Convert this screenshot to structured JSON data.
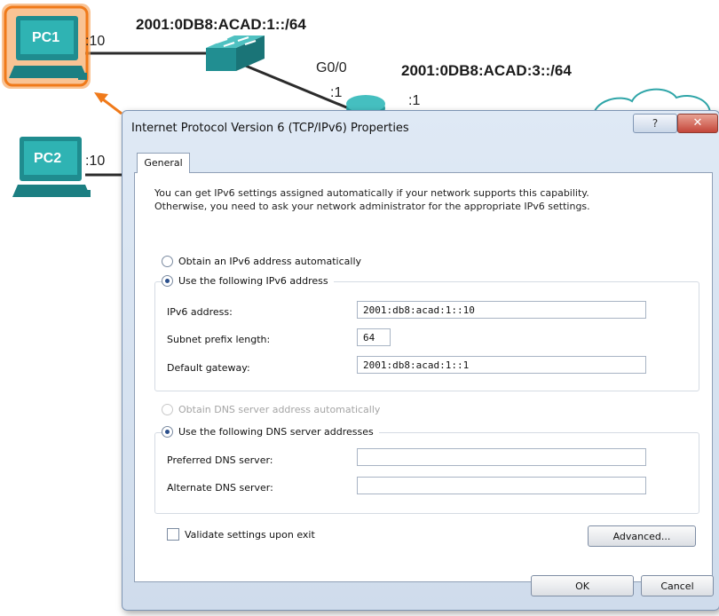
{
  "topology": {
    "lan1_prefix": "2001:0DB8:ACAD:1::/64",
    "lan3_prefix": "2001:0DB8:ACAD:3::/64",
    "pc1": {
      "name": "PC1",
      "suffix": ":10"
    },
    "pc2": {
      "name": "PC2",
      "suffix": ":10"
    },
    "router_port": "G0/0",
    "router_port_suffix": ":1",
    "router_right_suffix": ":1",
    "highlight_color": "#f07a1a"
  },
  "dialog": {
    "title": "Internet Protocol Version 6 (TCP/IPv6) Properties",
    "help_glyph": "?",
    "close_glyph": "✕",
    "tab_general": "General",
    "intro_line1": "You can get IPv6 settings assigned automatically if your network supports this capability.",
    "intro_line2": "Otherwise, you need to ask your network administrator for the appropriate IPv6 settings.",
    "radio_obtain_ip": "Obtain an IPv6 address automatically",
    "radio_use_ip": "Use the following IPv6 address",
    "ipv6_address_label": "IPv6 address:",
    "ipv6_address_value": "2001:db8:acad:1::10",
    "prefix_label": "Subnet prefix length:",
    "prefix_value": "64",
    "gateway_label": "Default gateway:",
    "gateway_value": "2001:db8:acad:1::1",
    "radio_obtain_dns": "Obtain DNS server address automatically",
    "radio_use_dns": "Use the following DNS server addresses",
    "preferred_dns_label": "Preferred DNS server:",
    "preferred_dns_value": "",
    "alternate_dns_label": "Alternate DNS server:",
    "alternate_dns_value": "",
    "validate_label": "Validate settings upon exit",
    "advanced_button": "Advanced...",
    "ok_button": "OK",
    "cancel_button": "Cancel"
  }
}
